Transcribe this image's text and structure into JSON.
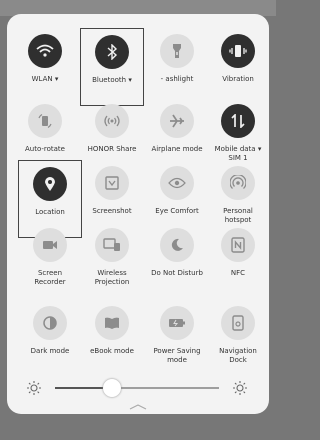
{
  "tiles": [
    {
      "label": "WLAN ▾",
      "icon": "wifi-icon",
      "state": "on"
    },
    {
      "label": "Bluetooth ▾",
      "icon": "bluetooth-icon",
      "state": "on"
    },
    {
      "label": "- ashlight",
      "icon": "flashlight-icon",
      "state": "off"
    },
    {
      "label": "Vibration",
      "icon": "vibration-icon",
      "state": "on"
    },
    {
      "label": "Auto-rotate",
      "icon": "auto-rotate-icon",
      "state": "off"
    },
    {
      "label": "HONOR Share",
      "icon": "honor-share-icon",
      "state": "off"
    },
    {
      "label": "Airplane mode",
      "icon": "airplane-icon",
      "state": "off"
    },
    {
      "label": "Mobile data ▾",
      "label2": "SIM 1",
      "icon": "mobile-data-icon",
      "state": "on"
    },
    {
      "label": "Location",
      "icon": "location-icon",
      "state": "on"
    },
    {
      "label": "Screenshot",
      "icon": "screenshot-icon",
      "state": "off"
    },
    {
      "label": "Eye Comfort",
      "icon": "eye-comfort-icon",
      "state": "off"
    },
    {
      "label": "Personal",
      "label2": "hotspot",
      "icon": "hotspot-icon",
      "state": "off"
    },
    {
      "label": "Screen",
      "label2": "Recorder",
      "icon": "screen-recorder-icon",
      "state": "off"
    },
    {
      "label": "Wireless",
      "label2": "Projection",
      "icon": "wireless-projection-icon",
      "state": "off"
    },
    {
      "label": "Do Not Disturb",
      "icon": "moon-icon",
      "state": "off"
    },
    {
      "label": "NFC",
      "icon": "nfc-icon",
      "state": "off"
    },
    {
      "label": "Dark mode",
      "icon": "dark-mode-icon",
      "state": "off"
    },
    {
      "label": "eBook mode",
      "icon": "ebook-icon",
      "state": "off"
    },
    {
      "label": "Power Saving",
      "label2": "mode",
      "icon": "battery-icon",
      "state": "off"
    },
    {
      "label": "Navigation",
      "label2": "Dock",
      "icon": "navigation-dock-icon",
      "state": "off"
    }
  ],
  "brightness": {
    "level": 0.35
  }
}
